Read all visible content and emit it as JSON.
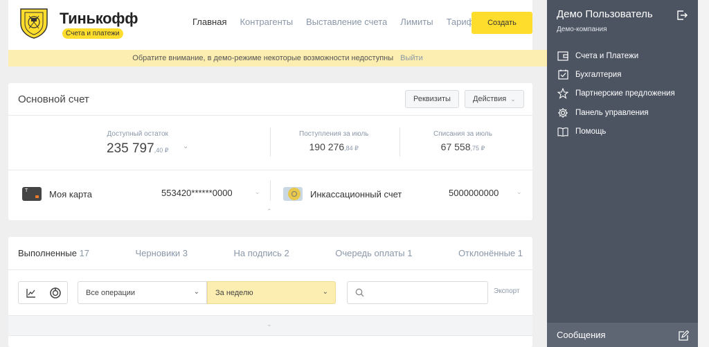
{
  "brand": {
    "name": "Тинькофф",
    "subtitle": "Счета и платежи"
  },
  "nav": {
    "items": [
      "Главная",
      "Контрагенты",
      "Выставление счета",
      "Лимиты",
      "Тарифы"
    ],
    "active": "Главная",
    "create_label": "Создать"
  },
  "notice": {
    "text": "Обратите внимание, в демо-режиме некоторые возможности недоступны",
    "exit_label": "Выйти"
  },
  "account": {
    "title": "Основной счет",
    "details_button": "Реквизиты",
    "actions_button": "Действия",
    "available": {
      "label": "Доступный остаток",
      "value": "235 797",
      "fraction": ",40 ₽"
    },
    "income": {
      "label": "Поступления за июль",
      "value": "190 276",
      "fraction": ",84 ₽"
    },
    "expense": {
      "label": "Списания за июль",
      "value": "67 558",
      "fraction": ",75 ₽"
    },
    "card": {
      "name": "Моя карта",
      "number": "553420******0000"
    },
    "collection": {
      "name": "Инкассационный счет",
      "number": "5000000000"
    }
  },
  "operations": {
    "tabs": [
      {
        "label": "Выполненные",
        "count": "17"
      },
      {
        "label": "Черновики",
        "count": "3"
      },
      {
        "label": "На подпись",
        "count": "2"
      },
      {
        "label": "Очередь оплаты",
        "count": "1"
      },
      {
        "label": "Отклонённые",
        "count": "1"
      }
    ],
    "active_tab": "Выполненные",
    "filter_operations": "Все операции",
    "filter_period": "За неделю",
    "search_value": "",
    "export_label": "Экспорт"
  },
  "sidebar": {
    "user_name": "Демо Пользователь",
    "company": "Демо-компания",
    "items": [
      {
        "label": "Счета и Платежи",
        "icon": "wallet-icon"
      },
      {
        "label": "Бухгалтерия",
        "icon": "calendar-check-icon"
      },
      {
        "label": "Партнерские предложения",
        "icon": "star-icon"
      },
      {
        "label": "Панель управления",
        "icon": "gear-icon"
      },
      {
        "label": "Помощь",
        "icon": "book-icon"
      }
    ],
    "messages_label": "Сообщения"
  },
  "colors": {
    "accent": "#ffdd2d",
    "notice": "#fbeeb0",
    "sidebar": "#4c5462",
    "muted": "#8a97a8"
  }
}
